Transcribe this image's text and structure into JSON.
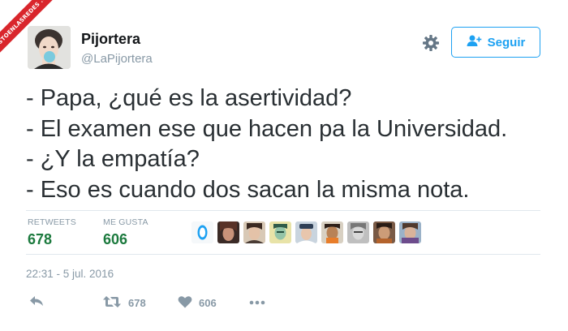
{
  "watermark": {
    "text": "VISTOENLASREDES .COM"
  },
  "profile": {
    "name": "Pijortera",
    "handle": "@LaPijortera",
    "follow_label": "Seguir"
  },
  "tweet": {
    "lines": [
      "- Papa, ¿qué es la asertividad?",
      "- El examen ese que hacen pa la Universidad.",
      "- ¿Y la empatía?",
      "- Eso es cuando dos sacan la misma nota."
    ]
  },
  "stats": {
    "retweets_label": "RETWEETS",
    "retweets_value": "678",
    "likes_label": "ME GUSTA",
    "likes_value": "606"
  },
  "timestamp": "22:31 - 5 jul. 2016",
  "actions": {
    "retweet_count": "678",
    "like_count": "606"
  },
  "colors": {
    "accent": "#1da1f2",
    "count_green": "#1c7a3e",
    "muted": "#8899a6",
    "watermark_red": "#d9262c"
  },
  "icons": [
    "gear-icon",
    "follow-user-icon",
    "reply-icon",
    "retweet-icon",
    "heart-icon",
    "more-icon"
  ]
}
